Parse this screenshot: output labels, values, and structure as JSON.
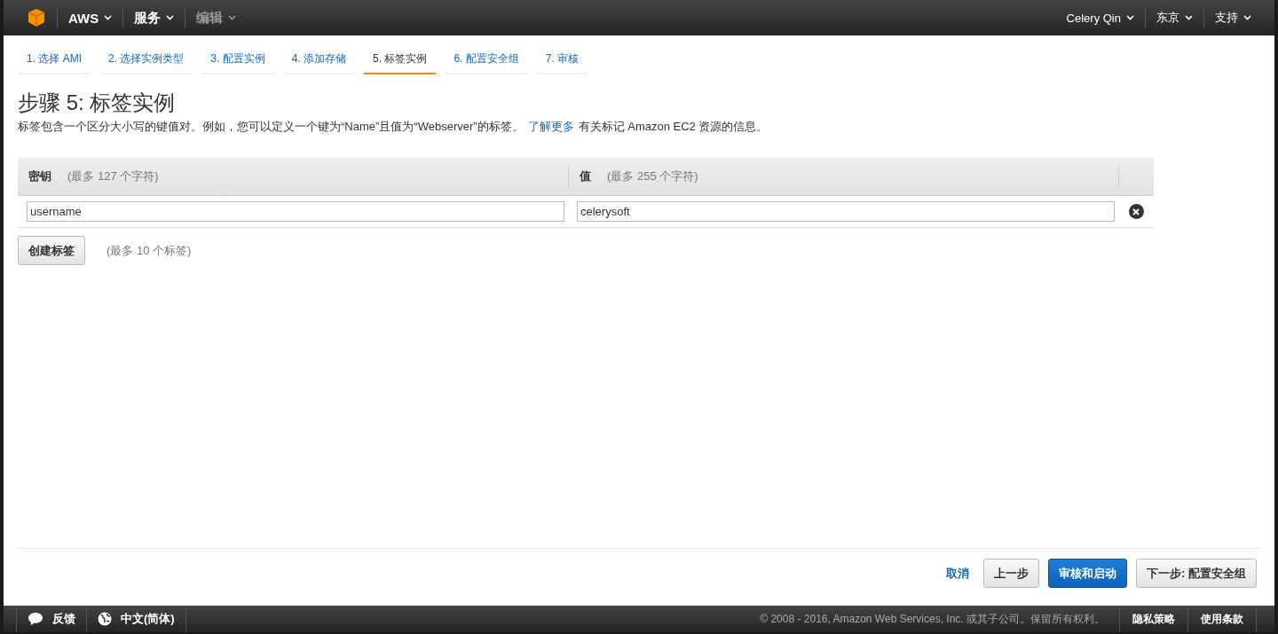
{
  "top_nav": {
    "left": [
      {
        "label": "AWS",
        "disabled": false
      },
      {
        "label": "服务",
        "disabled": false
      },
      {
        "label": "编辑",
        "disabled": true
      }
    ],
    "right": [
      "Celery Qin",
      "东京",
      "支持"
    ]
  },
  "steps": [
    {
      "label": "1. 选择 AMI",
      "selected": false
    },
    {
      "label": "2. 选择实例类型",
      "selected": false
    },
    {
      "label": "3. 配置实例",
      "selected": false
    },
    {
      "label": "4. 添加存储",
      "selected": false
    },
    {
      "label": "5. 标签实例",
      "selected": true
    },
    {
      "label": "6. 配置安全组",
      "selected": false
    },
    {
      "label": "7. 审核",
      "selected": false
    }
  ],
  "heading": "步骤 5: 标签实例",
  "description": "标签包含一个区分大小写的键值对。例如，您可以定义一个键为“Name”且值为“Webserver”的标签。",
  "learn_more": "了解更多",
  "description_tail": "有关标记 Amazon EC2 资源的信息。",
  "table": {
    "columns": [
      {
        "title": "密钥",
        "hint": "(最多 127 个字符)"
      },
      {
        "title": "值",
        "hint": "(最多 255 个字符)"
      }
    ],
    "rows": [
      {
        "key": "username",
        "value": "celerysoft"
      }
    ]
  },
  "create_button": "创建标签",
  "create_hint": "(最多 10 个标签)",
  "actions": {
    "cancel": "取消",
    "previous": "上一步",
    "review": "审核和启动",
    "next": "下一步: 配置安全组"
  },
  "footer": {
    "feedback": "反馈",
    "language": "中文(简体)",
    "copyright": "© 2008 - 2016, Amazon Web Services, Inc. 或其子公司。保留所有权利。",
    "links": [
      "隐私策略",
      "使用条款"
    ]
  }
}
